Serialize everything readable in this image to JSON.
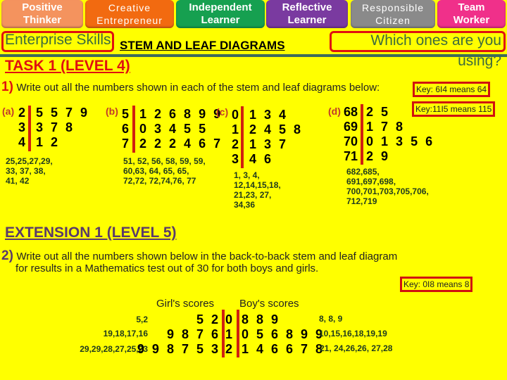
{
  "skills": [
    {
      "line1": "Positive",
      "line2": "Thinker",
      "color": "#f4935e"
    },
    {
      "line1": "Creative",
      "line2": "Entrepreneur",
      "color": "#f26a10"
    },
    {
      "line1": "Independent",
      "line2": "Learner",
      "color": "#16a050"
    },
    {
      "line1": "Reflective",
      "line2": "Learner",
      "color": "#7a3aa0"
    },
    {
      "line1": "Responsible",
      "line2": "Citizen",
      "color": "#8a8a8a"
    },
    {
      "line1": "Team",
      "line2": "Worker",
      "color": "#f0308a"
    }
  ],
  "header": {
    "enterprise_label": "Enterprise Skills",
    "title": "STEM AND LEAF DIAGRAMS",
    "which_line1": "Which ones are you",
    "which_line2": "using?"
  },
  "task1": {
    "heading": "TASK 1 (LEVEL 4)",
    "q_number": "1)",
    "q_text": "Write out all the numbers shown in each of the stem and leaf diagrams below:",
    "key1": "Key: 6I4 means 64",
    "key2": "Key:11I5 means 115",
    "diagrams": [
      {
        "label": "(a)",
        "rows": [
          {
            "stem": "2",
            "leaves": "5 5 7 9"
          },
          {
            "stem": "3",
            "leaves": "3 7 8"
          },
          {
            "stem": "4",
            "leaves": "1 2"
          }
        ],
        "answer": [
          "25,25,27,29,",
          "33, 37, 38,",
          "41, 42"
        ]
      },
      {
        "label": "(b)",
        "rows": [
          {
            "stem": "5",
            "leaves": "1 2 6 8 9 9"
          },
          {
            "stem": "6",
            "leaves": "0 3 4 5 5"
          },
          {
            "stem": "7",
            "leaves": "2 2 2 4 6 7"
          }
        ],
        "answer": [
          "51, 52, 56, 58, 59, 59,",
          "60,63, 64, 65, 65,",
          "72,72, 72,74,76, 77"
        ]
      },
      {
        "label": "(c)",
        "rows": [
          {
            "stem": "0",
            "leaves": "1 3 4"
          },
          {
            "stem": "1",
            "leaves": "2 4 5 8"
          },
          {
            "stem": "2",
            "leaves": "1 3 7"
          },
          {
            "stem": "3",
            "leaves": "4 6"
          }
        ],
        "answer": [
          "1, 3, 4,",
          "12,14,15,18,",
          "21,23, 27,",
          "34,36"
        ]
      },
      {
        "label": "(d)",
        "rows": [
          {
            "stem": "68",
            "leaves": "2 5"
          },
          {
            "stem": "69",
            "leaves": "1 7 8"
          },
          {
            "stem": "70",
            "leaves": "0 1 3 5 6"
          },
          {
            "stem": "71",
            "leaves": "2 9"
          }
        ],
        "answer": [
          "682,685,",
          "691,697,698,",
          "700,701,703,705,706,",
          "712,719"
        ]
      }
    ]
  },
  "extension": {
    "heading": "EXTENSION 1 (LEVEL 5)",
    "q_number": "2)",
    "q_text_line1": "Write out all the numbers shown below in the back-to-back stem and leaf diagram",
    "q_text_line2": "for results in a Mathematics test out of 30 for both boys and girls.",
    "key": "Key:  0I8 means 8",
    "girls_header": "Girl's scores",
    "boys_header": "Boy's scores",
    "rows": [
      {
        "girls_answer": "5,2",
        "girls_leaves": "5 2",
        "stem": "0",
        "boys_leaves": "8 8 9",
        "boys_answer": "8, 8, 9"
      },
      {
        "girls_answer": "19,18,17,16",
        "girls_leaves": "9 8 7 6",
        "stem": "1",
        "boys_leaves": "0 5 6 8 9 9",
        "boys_answer": "10,15,16,18,19,19"
      },
      {
        "girls_answer": "29,29,28,27,25,23",
        "girls_leaves": "9 9 8 7 5 3",
        "stem": "2",
        "boys_leaves": "1 4 6 6 7 8",
        "boys_answer": "21, 24,26,26, 27,28"
      }
    ]
  }
}
